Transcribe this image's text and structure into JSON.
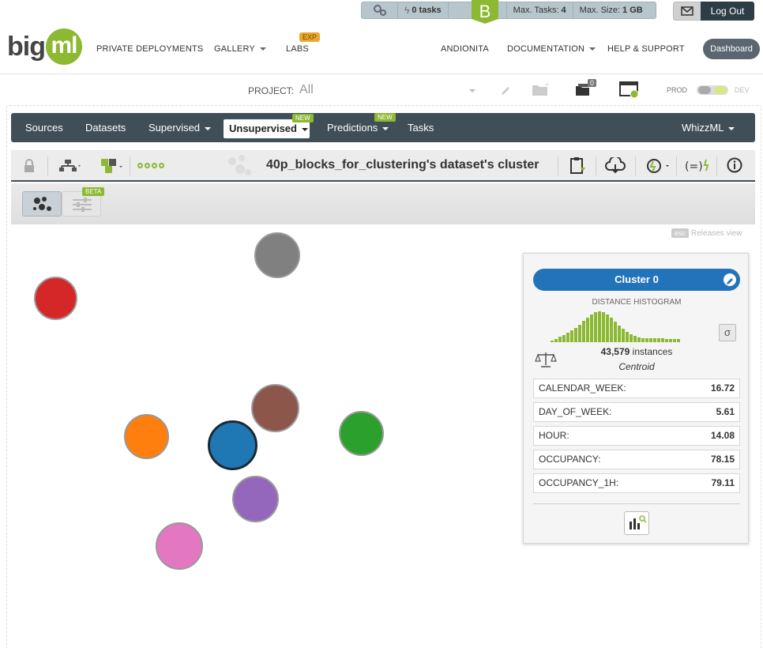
{
  "topbar": {
    "tasks": "0 tasks",
    "badge": "B",
    "max_tasks_label": "Max. Tasks:",
    "max_tasks_value": "4",
    "max_size_label": "Max. Size:",
    "max_size_value": "1 GB",
    "logout": "Log Out"
  },
  "nav": {
    "logo_big": "big",
    "logo_ml": "ml",
    "private_deployments": "PRIVATE DEPLOYMENTS",
    "gallery": "GALLERY",
    "labs": "LABS",
    "labs_badge": "EXP",
    "user": "ANDIONITA",
    "documentation": "DOCUMENTATION",
    "help": "HELP & SUPPORT",
    "dashboard": "Dashboard"
  },
  "project": {
    "label": "PROJECT:",
    "value": "All",
    "zero_count": "0",
    "prod": "PROD",
    "dev": "DEV"
  },
  "menu": {
    "sources": "Sources",
    "datasets": "Datasets",
    "supervised": "Supervised",
    "unsupervised": "Unsupervised",
    "unsupervised_badge": "NEW",
    "predictions": "Predictions",
    "predictions_badge": "NEW",
    "tasks": "Tasks",
    "whizzml": "WhizzML"
  },
  "toolbar": {
    "title": "40p_blocks_for_clustering's dataset's cluster"
  },
  "viewbar": {
    "beta_badge": "BETA"
  },
  "canvas": {
    "esc_key": "esc",
    "esc_text": "Releases view",
    "clusters": [
      {
        "color": "#808080"
      },
      {
        "color": "#d62728"
      },
      {
        "color": "#8c564b"
      },
      {
        "color": "#ff7f0e"
      },
      {
        "color": "#1f77b4",
        "selected": true
      },
      {
        "color": "#2ca02c"
      },
      {
        "color": "#9467bd"
      },
      {
        "color": "#e377c2"
      }
    ]
  },
  "panel": {
    "title": "Cluster 0",
    "histogram_title": "DISTANCE HISTOGRAM",
    "sigma": "σ",
    "instances_count": "43,579",
    "instances_label": "instances",
    "centroid": "Centroid",
    "fields": [
      {
        "name": "CALENDAR_WEEK:",
        "value": "16.72"
      },
      {
        "name": "DAY_OF_WEEK:",
        "value": "5.61"
      },
      {
        "name": "HOUR:",
        "value": "14.08"
      },
      {
        "name": "OCCUPANCY:",
        "value": "78.15"
      },
      {
        "name": "OCCUPANCY_1H:",
        "value": "79.11"
      }
    ],
    "histogram": [
      2,
      4,
      7,
      9,
      12,
      15,
      18,
      22,
      27,
      31,
      35,
      38,
      39,
      38,
      35,
      31,
      26,
      21,
      17,
      13,
      10,
      8,
      6,
      5,
      5,
      5,
      5,
      5,
      5,
      4,
      4,
      4,
      4
    ]
  },
  "colors": {
    "accent_green": "#8cb832",
    "dark_menu": "#404e58",
    "cluster_blue": "#2273b9"
  }
}
